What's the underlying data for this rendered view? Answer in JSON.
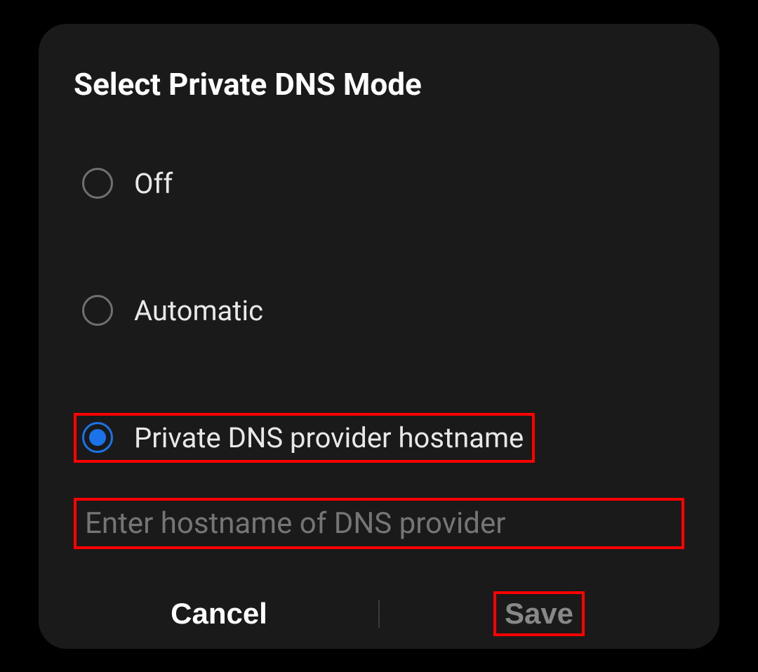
{
  "dialog": {
    "title": "Select Private DNS Mode",
    "options": [
      {
        "label": "Off",
        "selected": false,
        "highlighted": false
      },
      {
        "label": "Automatic",
        "selected": false,
        "highlighted": false
      },
      {
        "label": "Private DNS provider hostname",
        "selected": true,
        "highlighted": true
      }
    ],
    "input": {
      "placeholder": "Enter hostname of DNS provider",
      "value": ""
    },
    "buttons": {
      "cancel": "Cancel",
      "save": "Save"
    }
  }
}
